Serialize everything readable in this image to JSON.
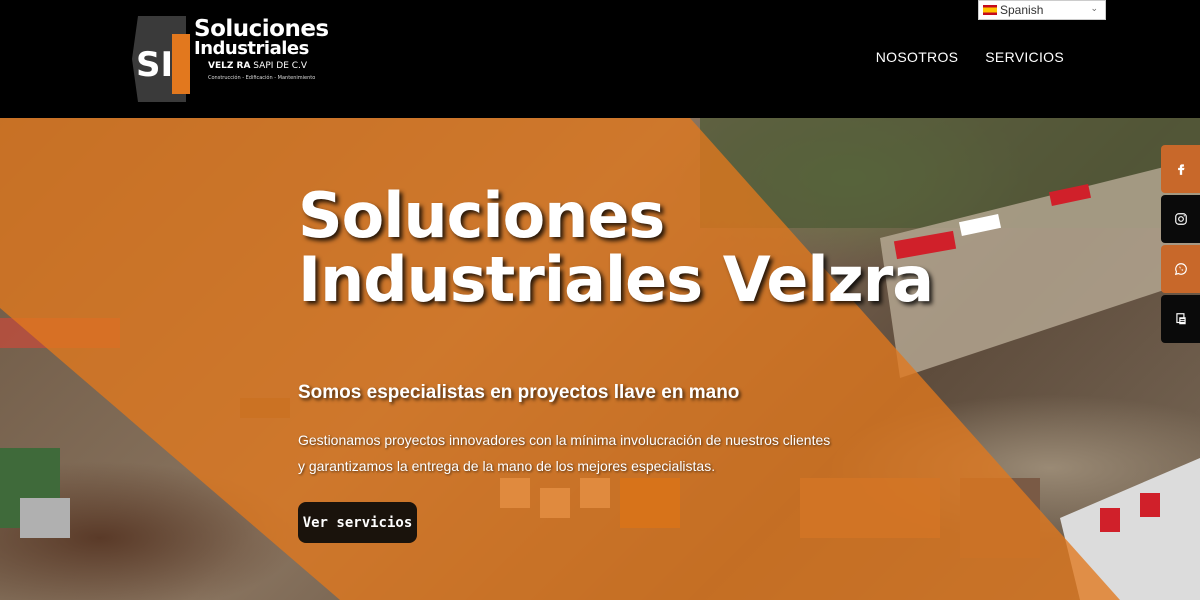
{
  "header": {
    "logo": {
      "mark": "SI",
      "title_line1": "Soluciones",
      "title_line2": "Industriales",
      "company_bold": "VELZ RA",
      "company_rest": "SAPI DE C.V",
      "tagline": "Construcción - Edificación - Mantenimiento"
    },
    "nav": [
      "NOSOTROS",
      "SERVICIOS"
    ],
    "language": {
      "selected": "Spanish"
    }
  },
  "hero": {
    "title_line1": "Soluciones",
    "title_line2": "Industriales Velzra",
    "subtitle": "Somos especialistas en proyectos llave en mano",
    "description": "Gestionamos proyectos innovadores con la mínima involucración de nuestros clientes y garantizamos la entrega de la mano de los mejores especialistas.",
    "button": "Ver servicios"
  },
  "social": [
    {
      "icon": "facebook-icon",
      "color": "#c8682a"
    },
    {
      "icon": "instagram-icon",
      "color": "#0a0a0a"
    },
    {
      "icon": "whatsapp-icon",
      "color": "#c8682a"
    },
    {
      "icon": "document-icon",
      "color": "#0a0a0a"
    }
  ],
  "colors": {
    "accent": "#e2781e",
    "header_bg": "#000000",
    "button_bg": "#1a130c"
  }
}
